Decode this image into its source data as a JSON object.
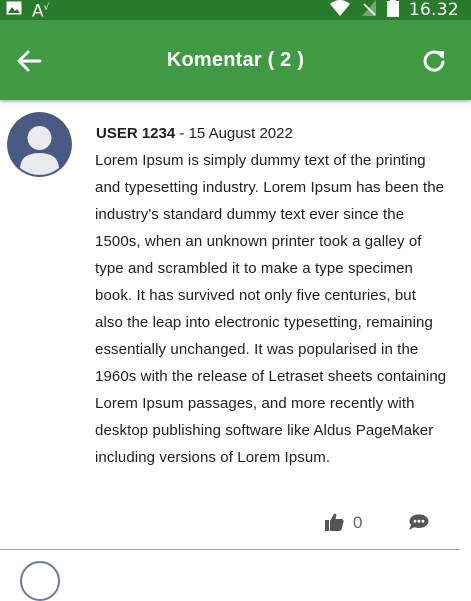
{
  "status_bar": {
    "time": "16.32",
    "icons": [
      "image-icon",
      "font-size-icon",
      "wifi-icon",
      "no-signal-icon",
      "battery-icon"
    ]
  },
  "app_bar": {
    "title": "Komentar ( 2 )",
    "back_icon": "arrow-left-icon",
    "refresh_icon": "refresh-icon",
    "background": "#3f9a43"
  },
  "comments": [
    {
      "user": "USER 1234",
      "separator": " - ",
      "date": "15 August 2022",
      "text": "Lorem Ipsum is simply dummy text of the printing and typesetting industry. Lorem Ipsum has been the industry's standard dummy text ever since the 1500s, when an unknown printer took a galley of type and scrambled it to make a type specimen book. It has survived not only five centuries, but also the leap into electronic typesetting, remaining essentially unchanged. It was popularised in the 1960s with the release of Letraset sheets containing Lorem Ipsum passages, and more recently with desktop publishing software like Aldus PageMaker including versions of Lorem Ipsum.",
      "likes": "0",
      "like_icon": "thumbs-up-icon",
      "reply_icon": "comment-bubble-icon"
    }
  ],
  "colors": {
    "status_bar": "#2a7a2d",
    "app_bar": "#3f9a43",
    "avatar": "#4a5a82",
    "icon_gray": "#555555"
  }
}
